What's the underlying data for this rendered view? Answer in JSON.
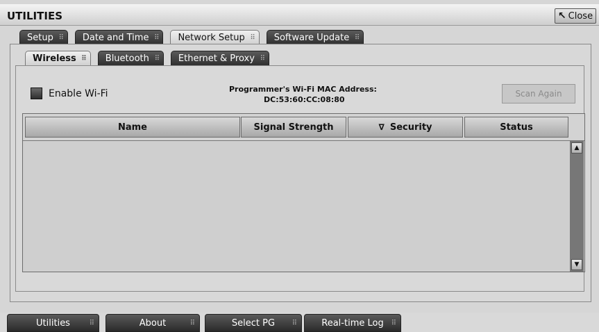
{
  "window": {
    "title": "UTILITIES",
    "close_label": "Close"
  },
  "tabs": [
    {
      "label": "Setup",
      "active": false
    },
    {
      "label": "Date and Time",
      "active": false
    },
    {
      "label": "Network Setup",
      "active": true
    },
    {
      "label": "Software Update",
      "active": false
    }
  ],
  "subtabs": [
    {
      "label": "Wireless",
      "active": true
    },
    {
      "label": "Bluetooth",
      "active": false
    },
    {
      "label": "Ethernet & Proxy",
      "active": false
    }
  ],
  "wifi": {
    "enable_label": "Enable Wi-Fi",
    "enabled": false,
    "mac_label": "Programmer's Wi-Fi MAC Address:",
    "mac_value": "DC:53:60:CC:08:80",
    "scan_label": "Scan Again"
  },
  "table": {
    "columns": [
      "Name",
      "Signal Strength",
      "Security",
      "Status"
    ],
    "sorted_column": "Security",
    "rows": []
  },
  "bottom_nav": [
    "Utilities",
    "About",
    "Select PG",
    "Real-time Log"
  ]
}
